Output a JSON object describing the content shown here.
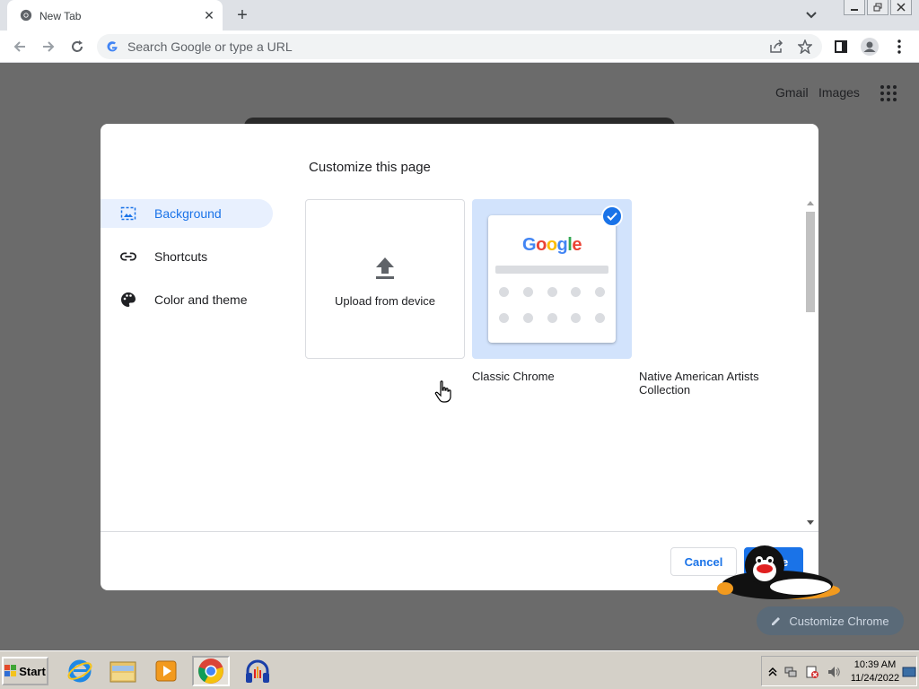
{
  "browser": {
    "tab_title": "New Tab",
    "omnibox_placeholder": "Search Google or type a URL"
  },
  "page": {
    "gmail_link": "Gmail",
    "images_link": "Images",
    "customize_chrome_label": "Customize Chrome"
  },
  "dialog": {
    "title": "Customize this page",
    "menu": [
      {
        "label": "Background",
        "icon": "image-icon",
        "active": true
      },
      {
        "label": "Shortcuts",
        "icon": "link-icon",
        "active": false
      },
      {
        "label": "Color and theme",
        "icon": "palette-icon",
        "active": false
      }
    ],
    "tiles": {
      "upload_label": "Upload from device",
      "classic_caption": "Classic Chrome",
      "classic_logo": "Google",
      "collection_caption": "Native American Artists Collection"
    },
    "cancel_label": "Cancel",
    "done_label": "Done"
  },
  "taskbar": {
    "start_label": "Start",
    "clock_time": "10:39 AM",
    "clock_date": "11/24/2022"
  },
  "colors": {
    "accent": "#1a73e8",
    "selected_tile": "#d2e3fc",
    "scrim": "#6b6b6b"
  }
}
